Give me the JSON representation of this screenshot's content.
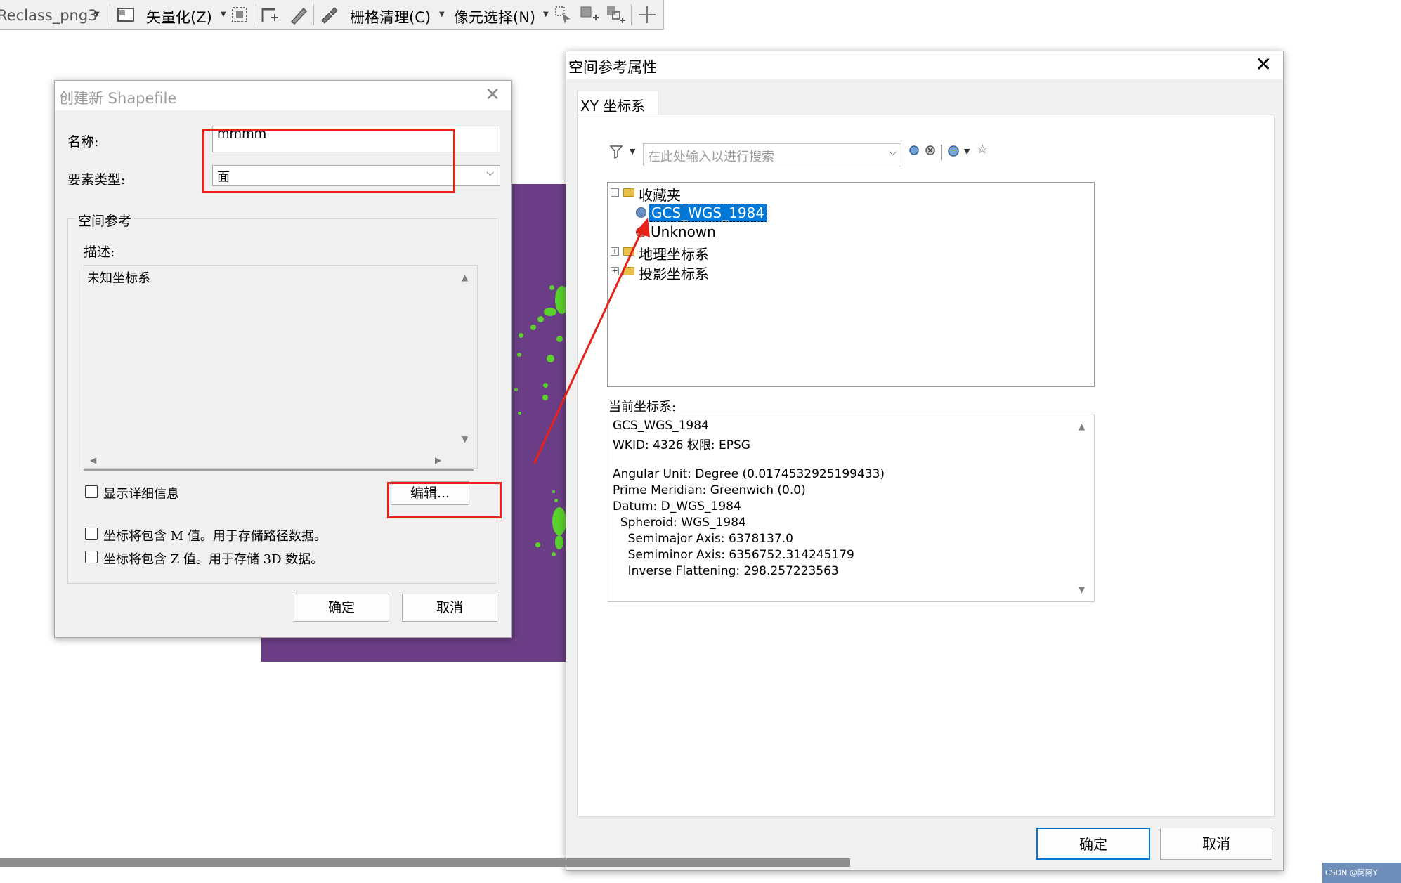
{
  "toolbar": {
    "layer_combo": "Reclass_png3",
    "vectorize": "矢量化(Z)",
    "raster_cleanup": "栅格清理(C)",
    "pixel_select": "像元选择(N)"
  },
  "create_shapefile": {
    "title": "创建新 Shapefile",
    "name_label": "名称:",
    "name_value": "mmmm",
    "feature_type_label": "要素类型:",
    "feature_type_value": "面",
    "spatial_ref_group": "空间参考",
    "description_label": "描述:",
    "description_text": "未知坐标系",
    "show_details_label": "显示详细信息",
    "edit_button": "编辑...",
    "m_values_label": "坐标将包含 M 值。用于存储路径数据。",
    "z_values_label": "坐标将包含 Z 值。用于存储 3D 数据。",
    "ok_button": "确定",
    "cancel_button": "取消"
  },
  "spatial_ref_props": {
    "title": "空间参考属性",
    "tab_label": "XY 坐标系",
    "search_placeholder": "在此处输入以进行搜索",
    "tree": {
      "favorites": "收藏夹",
      "gcs_wgs_1984": "GCS_WGS_1984",
      "unknown": "Unknown",
      "geographic": "地理坐标系",
      "projected": "投影坐标系"
    },
    "current_cs_label": "当前坐标系:",
    "current_cs_lines": [
      "GCS_WGS_1984",
      "WKID: 4326 权限: EPSG",
      "",
      "Angular Unit: Degree (0.0174532925199433)",
      "Prime Meridian: Greenwich (0.0)",
      "Datum: D_WGS_1984",
      "  Spheroid: WGS_1984",
      "    Semimajor Axis: 6378137.0",
      "    Semiminor Axis: 6356752.314245179",
      "    Inverse Flattening: 298.257223563"
    ],
    "ok_button": "确定",
    "cancel_button": "取消"
  },
  "watermark": "CSDN @阿阿Y",
  "colors": {
    "annotation_red": "#e8211a",
    "raster_purple": "#6b3d86",
    "raster_green": "#5ad12c",
    "selection_blue": "#0078d7"
  }
}
